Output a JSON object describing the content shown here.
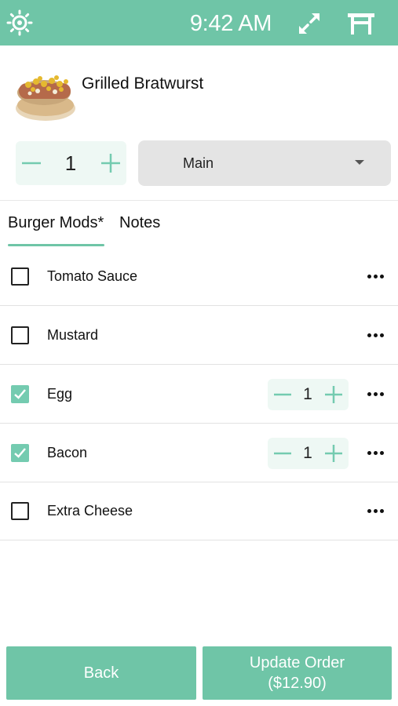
{
  "header": {
    "time": "9:42 AM",
    "logo_icon": "sun-logo-icon",
    "expand_icon": "expand-icon",
    "table_icon": "table-icon",
    "bg_color": "#6fc5a7"
  },
  "item": {
    "name": "Grilled Bratwurst",
    "photo_icon": "bratwurst-photo",
    "quantity": "1",
    "course": "Main"
  },
  "tabs": [
    {
      "label": "Burger Mods*",
      "active": true
    },
    {
      "label": "Notes",
      "active": false
    }
  ],
  "modifiers": [
    {
      "label": "Tomato Sauce",
      "checked": false
    },
    {
      "label": "Mustard",
      "checked": false
    },
    {
      "label": "Egg",
      "checked": true,
      "quantity": "1"
    },
    {
      "label": "Bacon",
      "checked": true,
      "quantity": "1"
    },
    {
      "label": "Extra Cheese",
      "checked": false
    }
  ],
  "footer": {
    "back_label": "Back",
    "update_label": "Update Order",
    "update_price": "($12.90)"
  },
  "colors": {
    "accent": "#6fc5a7",
    "checked": "#74cbb0",
    "stepper_bg": "#eef8f4",
    "select_bg": "#e4e4e4"
  }
}
